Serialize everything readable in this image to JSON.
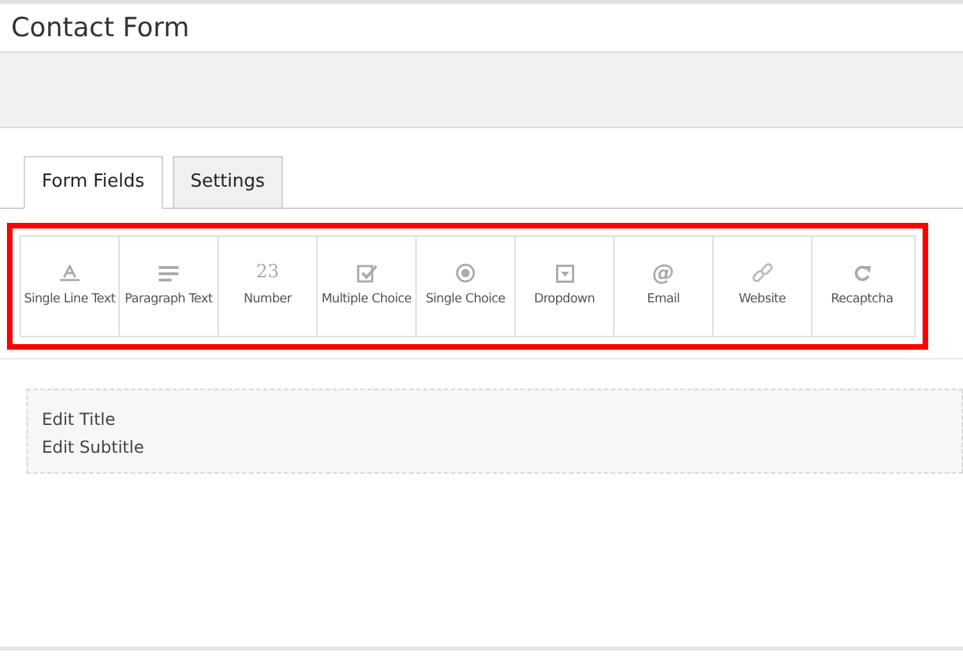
{
  "title": "Contact Form",
  "tabs": [
    {
      "label": "Form Fields",
      "selected": true
    },
    {
      "label": "Settings",
      "selected": false
    }
  ],
  "field_types": [
    {
      "kind": "single-line",
      "label": "Single Line Text"
    },
    {
      "kind": "paragraph",
      "label": "Paragraph Text"
    },
    {
      "kind": "number",
      "glyph": "23",
      "label": "Number"
    },
    {
      "kind": "checkbox",
      "label": "Multiple Choice"
    },
    {
      "kind": "radio",
      "label": "Single Choice"
    },
    {
      "kind": "dropdown",
      "label": "Dropdown"
    },
    {
      "kind": "email",
      "glyph": "@",
      "label": "Email"
    },
    {
      "kind": "link",
      "label": "Website"
    },
    {
      "kind": "refresh",
      "label": "Recaptcha"
    }
  ],
  "form_preview": {
    "title": "Edit Title",
    "subtitle": "Edit Subtitle"
  }
}
